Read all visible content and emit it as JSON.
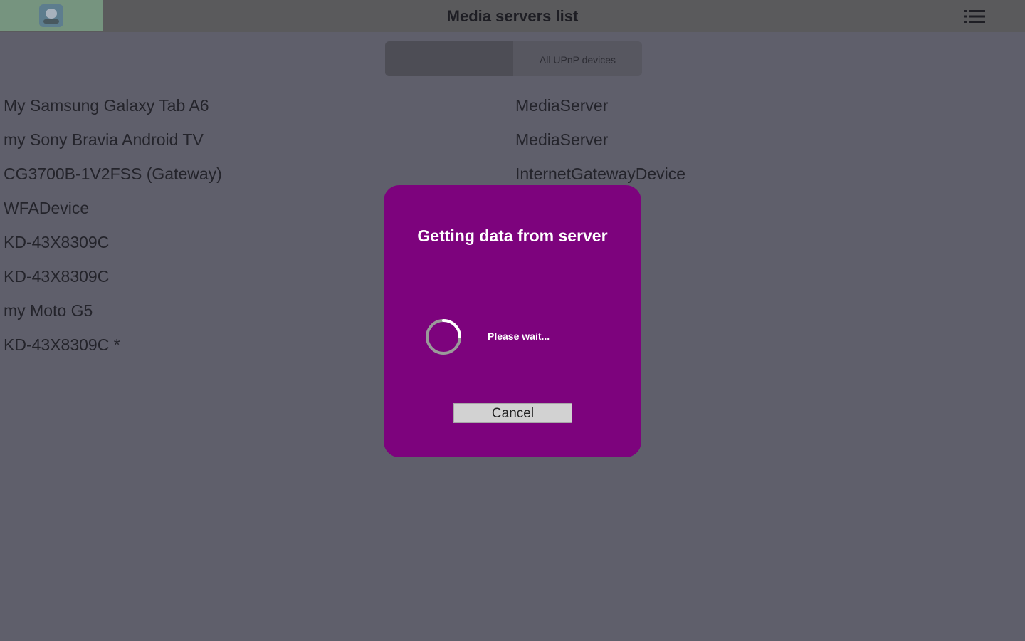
{
  "header": {
    "title": "Media servers list",
    "app_icon": "upnp-app-icon",
    "menu_icon": "list-menu-icon"
  },
  "segment": {
    "left_label": "",
    "right_label": "All UPnP devices"
  },
  "devices": [
    {
      "name": "My Samsung Galaxy Tab A6",
      "type": "MediaServer"
    },
    {
      "name": "my Sony Bravia Android TV",
      "type": "MediaServer"
    },
    {
      "name": "CG3700B-1V2FSS (Gateway)",
      "type": "InternetGatewayDevice"
    },
    {
      "name": "WFADevice",
      "type": ""
    },
    {
      "name": "KD-43X8309C",
      "type": ""
    },
    {
      "name": "KD-43X8309C",
      "type": ""
    },
    {
      "name": "my Moto G5",
      "type": ""
    },
    {
      "name": "KD-43X8309C *",
      "type": ""
    }
  ],
  "dialog": {
    "title": "Getting data from server",
    "message": "Please wait...",
    "cancel_label": "Cancel",
    "spinner_icon": "loading-spinner-icon"
  },
  "colors": {
    "dialog_bg": "#7d037d",
    "overlay_bg": "#5f5f6b",
    "header_bg": "#5a5a5c"
  }
}
